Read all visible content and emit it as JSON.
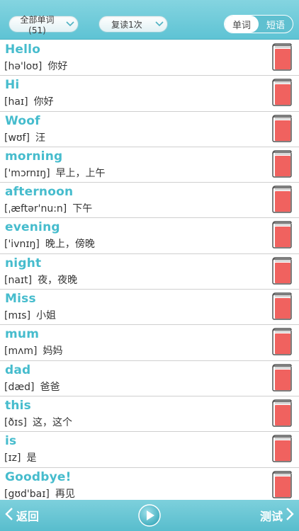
{
  "header": {
    "filter_label": "全部单词(51)",
    "review_label": "复读1次",
    "tabs": [
      {
        "label": "单词",
        "active": true
      },
      {
        "label": "短语",
        "active": false
      }
    ]
  },
  "words": [
    {
      "word": "Hello",
      "phonetic": "[hə'loʊ]",
      "meaning": "你好"
    },
    {
      "word": "Hi",
      "phonetic": "[haɪ]",
      "meaning": "你好"
    },
    {
      "word": "Woof",
      "phonetic": "[wʊf]",
      "meaning": "汪"
    },
    {
      "word": "morning",
      "phonetic": "['mɔrnɪŋ]",
      "meaning": "早上，上午"
    },
    {
      "word": "afternoon",
      "phonetic": "[ˌæftər'nu:n]",
      "meaning": "下午"
    },
    {
      "word": "evening",
      "phonetic": "['ivnɪŋ]",
      "meaning": "晚上，傍晚"
    },
    {
      "word": "night",
      "phonetic": "[naɪt]",
      "meaning": "夜，夜晚"
    },
    {
      "word": "Miss",
      "phonetic": "[mɪs]",
      "meaning": "小姐"
    },
    {
      "word": "mum",
      "phonetic": "[mʌm]",
      "meaning": "妈妈"
    },
    {
      "word": "dad",
      "phonetic": "[dæd]",
      "meaning": "爸爸"
    },
    {
      "word": "this",
      "phonetic": "[ðɪs]",
      "meaning": "这，这个"
    },
    {
      "word": "is",
      "phonetic": "[ɪz]",
      "meaning": "是"
    },
    {
      "word": "Goodbye!",
      "phonetic": "[gʊd'baɪ]",
      "meaning": "再见"
    }
  ],
  "footer": {
    "back_label": "返回",
    "test_label": "测试"
  },
  "colors": {
    "accent": "#46bccd",
    "bar": "#5ec3d4",
    "book": "#f0625f"
  },
  "icons": {
    "row_action": "book-icon",
    "play": "play-icon",
    "back": "chevron-left-icon",
    "next": "chevron-right-icon"
  }
}
